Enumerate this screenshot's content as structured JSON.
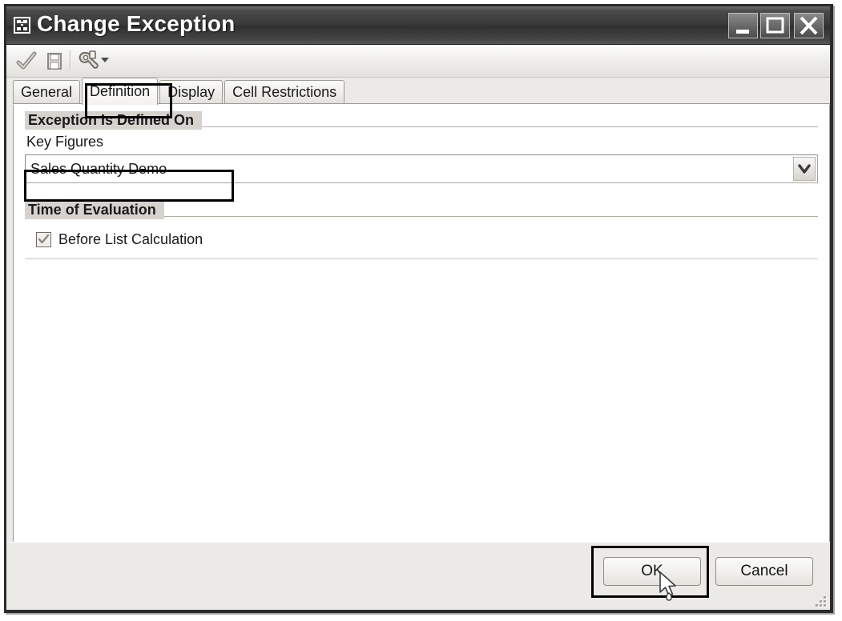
{
  "window": {
    "title": "Change Exception",
    "icon": "hierarchy-icon",
    "controls": {
      "minimize": "Minimize",
      "maximize": "Maximize",
      "close": "Close"
    }
  },
  "toolbar": {
    "items": [
      {
        "name": "check-apply-icon",
        "tooltip": "Check"
      },
      {
        "name": "save-icon",
        "tooltip": "Save"
      },
      {
        "name": "tools-wrench-icon",
        "tooltip": "Tools"
      }
    ],
    "dropdown_caret": "chevron-down-icon"
  },
  "tabs": [
    {
      "label": "General",
      "active": false
    },
    {
      "label": "Definition",
      "active": true
    },
    {
      "label": "Display",
      "active": false
    },
    {
      "label": "Cell Restrictions",
      "active": false
    }
  ],
  "groups": {
    "defined_on": {
      "title": "Exception Is Defined On",
      "field_label": "Key Figures",
      "combo": {
        "value": "Sales Quantity Demo",
        "placeholder": "",
        "arrow_icon": "chevron-down-icon"
      }
    },
    "time_of_evaluation": {
      "title": "Time of Evaluation",
      "checkbox": {
        "label": "Before List Calculation",
        "checked": true,
        "disabled": true
      }
    }
  },
  "footer": {
    "ok_label": "OK",
    "cancel_label": "Cancel",
    "resize_grip": "resize-grip-icon"
  },
  "annotations": {
    "tab_highlight": "Definition",
    "combo_highlight": "Sales Quantity Demo",
    "ok_highlight": "OK"
  },
  "colors": {
    "titlebar_dark": "#3a3a3a",
    "window_border": "#2b2b2b",
    "dialog_face": "#eceae6",
    "client_bg": "#ffffff",
    "group_header_bg": "#d6d3ce",
    "annotation": "#000000",
    "text": "#1a1a1a"
  }
}
